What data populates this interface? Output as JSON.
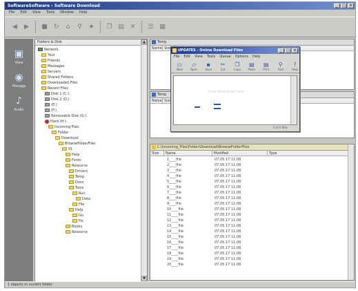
{
  "window": {
    "title": "SoftwareSoftware - Software Download"
  },
  "menu": [
    "File",
    "Edit",
    "View",
    "Tools",
    "Window",
    "Help"
  ],
  "toolbar_icons": [
    "back-icon",
    "forward-icon",
    "stop-icon",
    "refresh-icon",
    "home-icon",
    "search-icon",
    "favorites-icon",
    "copy-icon",
    "paste-icon",
    "delete-icon",
    "properties-icon",
    "views-icon"
  ],
  "leftbar": [
    {
      "label": "View",
      "icon": "monitor-icon"
    },
    {
      "label": "Manage",
      "icon": "disk-icon"
    },
    {
      "label": "Audio",
      "icon": "speaker-icon"
    }
  ],
  "tree": {
    "header": "Folders & Disk",
    "nodes": [
      {
        "label": "Network",
        "indent": 0,
        "kind": "net"
      },
      {
        "label": "Your",
        "indent": 1,
        "kind": "folder"
      },
      {
        "label": "Friends",
        "indent": 1,
        "kind": "folder"
      },
      {
        "label": "Messages",
        "indent": 1,
        "kind": "folder"
      },
      {
        "label": "Servers",
        "indent": 1,
        "kind": "folder"
      },
      {
        "label": "Shared Folders",
        "indent": 1,
        "kind": "folder"
      },
      {
        "label": "Downloaded Files",
        "indent": 1,
        "kind": "folder"
      },
      {
        "label": "Recent Files",
        "indent": 1,
        "kind": "folder"
      },
      {
        "label": "Disk 1 (C:)",
        "indent": 2,
        "kind": "drive"
      },
      {
        "label": "Disk 2 (D:)",
        "indent": 2,
        "kind": "drive"
      },
      {
        "label": "(E:)",
        "indent": 2,
        "kind": "drive"
      },
      {
        "label": "(F:)",
        "indent": 2,
        "kind": "drive"
      },
      {
        "label": "Removable Disk (G:)",
        "indent": 2,
        "kind": "drive"
      },
      {
        "label": "Hard (H:)",
        "indent": 2,
        "kind": "red"
      },
      {
        "label": "Incoming Files",
        "indent": 3,
        "kind": "folder"
      },
      {
        "label": "Folder",
        "indent": 4,
        "kind": "folder"
      },
      {
        "label": "Download",
        "indent": 5,
        "kind": "folder"
      },
      {
        "label": "BrowseFolderFiles",
        "indent": 6,
        "kind": "folder"
      },
      {
        "label": "01",
        "indent": 7,
        "kind": "folder"
      },
      {
        "label": "Help",
        "indent": 8,
        "kind": "folder"
      },
      {
        "label": "Fonts",
        "indent": 8,
        "kind": "folder"
      },
      {
        "label": "Resource",
        "indent": 8,
        "kind": "folder"
      },
      {
        "label": "Drivers",
        "indent": 9,
        "kind": "folder"
      },
      {
        "label": "Temp",
        "indent": 9,
        "kind": "folder"
      },
      {
        "label": "Docs",
        "indent": 9,
        "kind": "folder"
      },
      {
        "label": "Tools",
        "indent": 9,
        "kind": "folder"
      },
      {
        "label": "Run",
        "indent": 10,
        "kind": "folder"
      },
      {
        "label": "Data",
        "indent": 11,
        "kind": "folder"
      },
      {
        "label": "File",
        "indent": 10,
        "kind": "folder"
      },
      {
        "label": "Help",
        "indent": 9,
        "kind": "folder"
      },
      {
        "label": "Go",
        "indent": 10,
        "kind": "folder"
      },
      {
        "label": "Fix",
        "indent": 10,
        "kind": "folder"
      },
      {
        "label": "Books",
        "indent": 8,
        "kind": "folder"
      },
      {
        "label": "Resource",
        "indent": 8,
        "kind": "folder"
      }
    ]
  },
  "top_win": {
    "title": "Temp",
    "cols": [
      "Name",
      "Size"
    ]
  },
  "mid_win": {
    "title": "Temp",
    "cols": [
      "Name",
      "Size"
    ]
  },
  "files_win": {
    "title": "C:\\Incoming_Files\\Folder\\Download\\BrowseFolderFiles",
    "cols": [
      "Size",
      "Name",
      "Modified",
      "Type"
    ],
    "rows": [
      {
        "name": "1____file",
        "date": "07.05.17 11:08"
      },
      {
        "name": "2____file",
        "date": "07.05.17 11:08"
      },
      {
        "name": "3____file",
        "date": "07.05.17 11:08"
      },
      {
        "name": "4____file",
        "date": "07.05.17 11:08"
      },
      {
        "name": "5____file",
        "date": "07.05.17 11:08"
      },
      {
        "name": "6____file",
        "date": "07.05.17 11:08"
      },
      {
        "name": "7____file",
        "date": "07.05.17 11:08"
      },
      {
        "name": "8____file",
        "date": "07.05.17 11:08"
      },
      {
        "name": "9____file",
        "date": "07.05.17 11:08"
      },
      {
        "name": "10____file",
        "date": "07.05.17 11:08"
      },
      {
        "name": "11____file",
        "date": "07.05.17 11:08"
      },
      {
        "name": "12____file",
        "date": "07.05.17 11:08"
      },
      {
        "name": "13____file",
        "date": "07.05.17 11:08"
      },
      {
        "name": "14____file",
        "date": "07.05.17 11:08"
      },
      {
        "name": "15____file",
        "date": "07.05.17 11:08"
      },
      {
        "name": "16____file",
        "date": "07.05.17 11:08"
      },
      {
        "name": "17____file",
        "date": "07.05.17 11:08"
      },
      {
        "name": "18____file",
        "date": "07.05.17 11:08"
      },
      {
        "name": "19____file",
        "date": "07.05.17 11:08"
      },
      {
        "name": "20____file",
        "date": "07.05.17 11:08"
      }
    ]
  },
  "dialog": {
    "title": "UPDATES - Online Download Files",
    "menu": [
      "File",
      "Edit",
      "View",
      "Tools",
      "Queue",
      "Options",
      "Help"
    ],
    "tools": [
      {
        "label": "New",
        "icon": "new-icon"
      },
      {
        "label": "Open",
        "icon": "open-icon"
      },
      {
        "label": "Save",
        "icon": "save-icon"
      },
      {
        "label": "Cut",
        "icon": "cut-icon"
      },
      {
        "label": "Copy",
        "icon": "copy-icon"
      },
      {
        "label": "Paste",
        "icon": "paste-icon"
      },
      {
        "label": "Print",
        "icon": "print-icon"
      },
      {
        "label": "Find",
        "icon": "find-icon"
      },
      {
        "label": "Help",
        "icon": "help-icon"
      }
    ],
    "body_text": "Drop Download Here",
    "status": "0 of 0 files"
  },
  "status": "1 objects in current folder",
  "colors": {
    "title_start": "#1f3a8a",
    "title_end": "#6f8fd0",
    "folder": "#f1d55a",
    "accent": "#2a4fc0"
  }
}
